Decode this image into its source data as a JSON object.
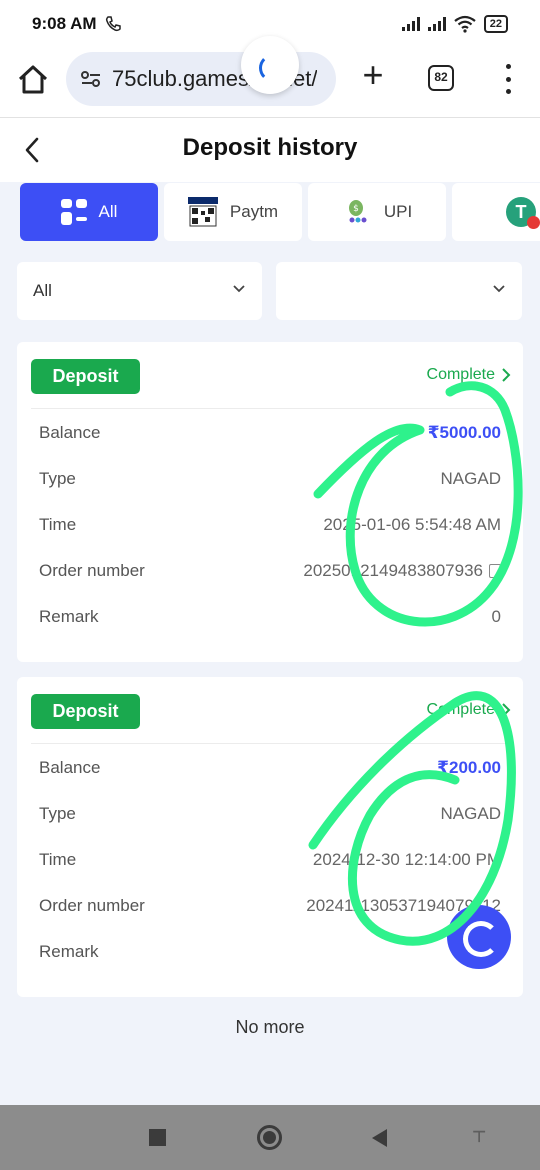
{
  "status_bar": {
    "time": "9:08 AM",
    "battery": "22"
  },
  "browser": {
    "url": "75club.games/wallet/",
    "tab_count": "82"
  },
  "page": {
    "title": "Deposit history"
  },
  "tabs": [
    {
      "label": "All",
      "icon": "grid-icon",
      "active": true
    },
    {
      "label": "Paytm",
      "icon": "paytm-icon",
      "active": false
    },
    {
      "label": "UPI",
      "icon": "upi-icon",
      "active": false
    },
    {
      "label": "",
      "icon": "tether-icon",
      "active": false
    }
  ],
  "filters": {
    "type": "All",
    "date": ""
  },
  "labels": {
    "balance": "Balance",
    "type": "Type",
    "time": "Time",
    "order_number": "Order number",
    "remark": "Remark"
  },
  "records": [
    {
      "badge": "Deposit",
      "status": "Complete",
      "balance": "₹5000.00",
      "type": "NAGAD",
      "time": "2025-01-06 5:54:48 AM",
      "order_number": "2025012149483807936",
      "remark": "0"
    },
    {
      "badge": "Deposit",
      "status": "Complete",
      "balance": "₹200.00",
      "type": "NAGAD",
      "time": "2024-12-30 12:14:00 PM",
      "order_number": "202411130537194079112",
      "remark": ""
    }
  ],
  "footer": {
    "no_more": "No more"
  },
  "colors": {
    "accent": "#3d4ff5",
    "success": "#1aa94e",
    "annotation": "#2ef28c"
  }
}
